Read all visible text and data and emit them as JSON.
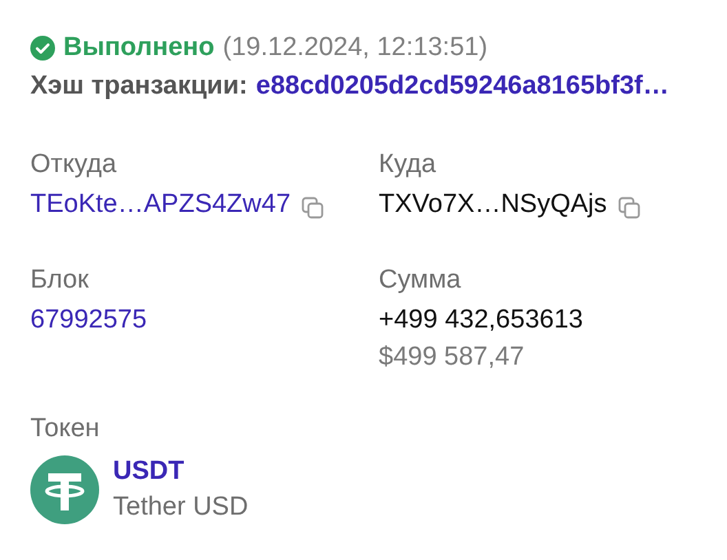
{
  "status": {
    "kind": "success",
    "label": "Выполнено",
    "time": "(19.12.2024, 12:13:51)"
  },
  "hash": {
    "label": "Хэш транзакции:",
    "value": "e88cd0205d2cd59246a8165bf3f…"
  },
  "fields": [
    {
      "label": "Откуда",
      "value": "TEoKte…APZS4Zw47",
      "kind": "link",
      "copyable": true
    },
    {
      "label": "Куда",
      "value": "TXVo7X…NSyQAjs",
      "kind": "plain",
      "copyable": true
    },
    {
      "label": "Блок",
      "value": "67992575",
      "kind": "link",
      "copyable": false
    },
    {
      "label": "Сумма",
      "value": "+499 432,653613",
      "secondary": "$499 587,47",
      "kind": "plain",
      "copyable": false
    }
  ],
  "token": {
    "label": "Токен",
    "symbol": "USDT",
    "name": "Tether USD"
  }
}
